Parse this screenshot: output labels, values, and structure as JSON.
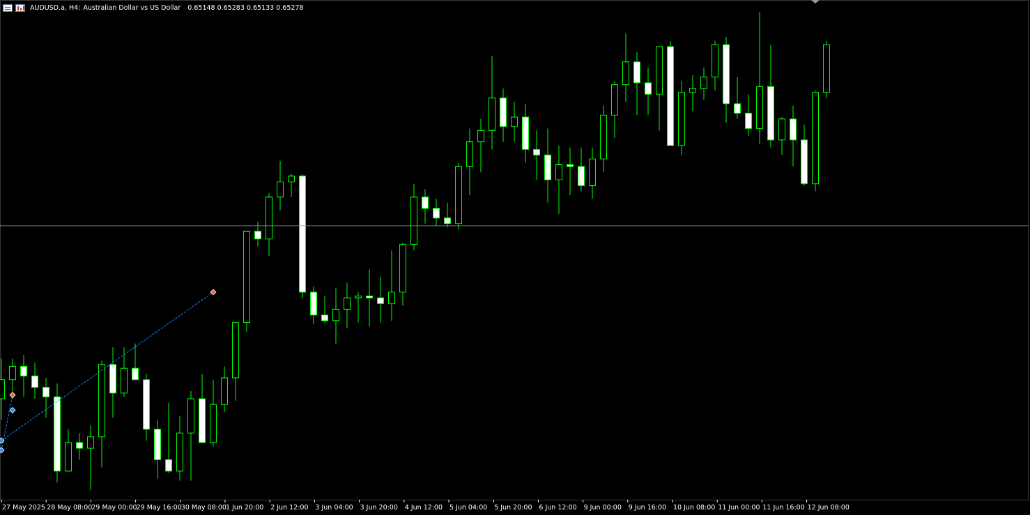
{
  "header": {
    "symbol_timeframe": "AUDUSD.a, H4:",
    "description": "Australian Dollar vs US Dollar",
    "quote": "0.65148 0.65283 0.65133 0.65278",
    "menu_icon": "window-menu-icon",
    "chart_icon": "bar-chart-icon"
  },
  "colors": {
    "background": "#000000",
    "candle_outline": "#00ff00",
    "bull_body": "#000000",
    "bear_body": "#ffffff",
    "price_line": "#8b9dae",
    "buy_marker": "#1e90ff",
    "sell_marker": "#ff5a36",
    "trade_line": "#1e90ff"
  },
  "chart_data": {
    "type": "candlestick",
    "symbol": "AUDUSD.a",
    "timeframe": "H4",
    "grid": false,
    "current_price": 0.65278,
    "x_labels": [
      "27 May 2025",
      "28 May 08:00",
      "29 May 00:00",
      "29 May 16:00",
      "30 May 08:00",
      "1 Jun 20:00",
      "2 Jun 12:00",
      "3 Jun 04:00",
      "3 Jun 20:00",
      "4 Jun 12:00",
      "5 Jun 04:00",
      "5 Jun 20:00",
      "6 Jun 12:00",
      "9 Jun 00:00",
      "9 Jun 16:00",
      "10 Jun 08:00",
      "11 Jun 00:00",
      "11 Jun 16:00",
      "12 Jun 08:00"
    ],
    "candles": [
      {
        "o": 0.6437,
        "h": 0.6458,
        "l": 0.6426,
        "c": 0.6447
      },
      {
        "o": 0.6447,
        "h": 0.6458,
        "l": 0.6437,
        "c": 0.6454
      },
      {
        "o": 0.6454,
        "h": 0.646,
        "l": 0.6438,
        "c": 0.6449
      },
      {
        "o": 0.6449,
        "h": 0.6456,
        "l": 0.6437,
        "c": 0.6443
      },
      {
        "o": 0.6443,
        "h": 0.6448,
        "l": 0.6427,
        "c": 0.6438
      },
      {
        "o": 0.6438,
        "h": 0.6445,
        "l": 0.6393,
        "c": 0.6399
      },
      {
        "o": 0.6399,
        "h": 0.6421,
        "l": 0.6399,
        "c": 0.6414
      },
      {
        "o": 0.6414,
        "h": 0.6419,
        "l": 0.6405,
        "c": 0.6411
      },
      {
        "o": 0.6411,
        "h": 0.6423,
        "l": 0.6389,
        "c": 0.6417
      },
      {
        "o": 0.6417,
        "h": 0.6457,
        "l": 0.6401,
        "c": 0.6455
      },
      {
        "o": 0.6455,
        "h": 0.6464,
        "l": 0.6427,
        "c": 0.644
      },
      {
        "o": 0.644,
        "h": 0.6464,
        "l": 0.6438,
        "c": 0.6453
      },
      {
        "o": 0.6453,
        "h": 0.6466,
        "l": 0.6447,
        "c": 0.6447
      },
      {
        "o": 0.6447,
        "h": 0.645,
        "l": 0.6415,
        "c": 0.6421
      },
      {
        "o": 0.6421,
        "h": 0.6426,
        "l": 0.6395,
        "c": 0.6405
      },
      {
        "o": 0.6405,
        "h": 0.6435,
        "l": 0.6398,
        "c": 0.6399
      },
      {
        "o": 0.6399,
        "h": 0.6428,
        "l": 0.6394,
        "c": 0.6419
      },
      {
        "o": 0.6419,
        "h": 0.6441,
        "l": 0.6394,
        "c": 0.6437
      },
      {
        "o": 0.6437,
        "h": 0.645,
        "l": 0.6418,
        "c": 0.6414
      },
      {
        "o": 0.6414,
        "h": 0.6447,
        "l": 0.6412,
        "c": 0.6434
      },
      {
        "o": 0.6434,
        "h": 0.6454,
        "l": 0.643,
        "c": 0.6448
      },
      {
        "o": 0.6448,
        "h": 0.6467,
        "l": 0.6436,
        "c": 0.6477
      },
      {
        "o": 0.6477,
        "h": 0.6515,
        "l": 0.6472,
        "c": 0.6525
      },
      {
        "o": 0.6525,
        "h": 0.653,
        "l": 0.6517,
        "c": 0.6521
      },
      {
        "o": 0.6521,
        "h": 0.6545,
        "l": 0.6512,
        "c": 0.6543
      },
      {
        "o": 0.6543,
        "h": 0.6562,
        "l": 0.6536,
        "c": 0.6551
      },
      {
        "o": 0.6551,
        "h": 0.6555,
        "l": 0.6543,
        "c": 0.6554
      },
      {
        "o": 0.6554,
        "h": 0.6555,
        "l": 0.649,
        "c": 0.6493
      },
      {
        "o": 0.6493,
        "h": 0.6496,
        "l": 0.6476,
        "c": 0.6481
      },
      {
        "o": 0.6481,
        "h": 0.6491,
        "l": 0.6477,
        "c": 0.6478
      },
      {
        "o": 0.6478,
        "h": 0.6495,
        "l": 0.6466,
        "c": 0.6484
      },
      {
        "o": 0.6484,
        "h": 0.6498,
        "l": 0.6474,
        "c": 0.649
      },
      {
        "o": 0.649,
        "h": 0.6493,
        "l": 0.6477,
        "c": 0.6491
      },
      {
        "o": 0.6491,
        "h": 0.6505,
        "l": 0.6475,
        "c": 0.649
      },
      {
        "o": 0.649,
        "h": 0.6501,
        "l": 0.6477,
        "c": 0.6487
      },
      {
        "o": 0.6487,
        "h": 0.6515,
        "l": 0.6478,
        "c": 0.6493
      },
      {
        "o": 0.6493,
        "h": 0.6519,
        "l": 0.6486,
        "c": 0.6518
      },
      {
        "o": 0.6518,
        "h": 0.655,
        "l": 0.6515,
        "c": 0.6543
      },
      {
        "o": 0.6543,
        "h": 0.6547,
        "l": 0.6529,
        "c": 0.6537
      },
      {
        "o": 0.6537,
        "h": 0.6542,
        "l": 0.6528,
        "c": 0.6532
      },
      {
        "o": 0.6532,
        "h": 0.654,
        "l": 0.6527,
        "c": 0.6529
      },
      {
        "o": 0.6529,
        "h": 0.6561,
        "l": 0.6526,
        "c": 0.6559
      },
      {
        "o": 0.6559,
        "h": 0.6579,
        "l": 0.6544,
        "c": 0.6572
      },
      {
        "o": 0.6572,
        "h": 0.6584,
        "l": 0.6556,
        "c": 0.6578
      },
      {
        "o": 0.6578,
        "h": 0.6617,
        "l": 0.6568,
        "c": 0.6595
      },
      {
        "o": 0.6595,
        "h": 0.66,
        "l": 0.6572,
        "c": 0.658
      },
      {
        "o": 0.658,
        "h": 0.6593,
        "l": 0.6572,
        "c": 0.6585
      },
      {
        "o": 0.6585,
        "h": 0.6592,
        "l": 0.6561,
        "c": 0.6568
      },
      {
        "o": 0.6568,
        "h": 0.6578,
        "l": 0.6552,
        "c": 0.6565
      },
      {
        "o": 0.6565,
        "h": 0.6579,
        "l": 0.654,
        "c": 0.6552
      },
      {
        "o": 0.6552,
        "h": 0.657,
        "l": 0.6534,
        "c": 0.656
      },
      {
        "o": 0.656,
        "h": 0.6569,
        "l": 0.6544,
        "c": 0.6559
      },
      {
        "o": 0.6559,
        "h": 0.6569,
        "l": 0.6546,
        "c": 0.6549
      },
      {
        "o": 0.6549,
        "h": 0.6569,
        "l": 0.6542,
        "c": 0.6563
      },
      {
        "o": 0.6563,
        "h": 0.6591,
        "l": 0.6556,
        "c": 0.6586
      },
      {
        "o": 0.6586,
        "h": 0.6604,
        "l": 0.6574,
        "c": 0.6602
      },
      {
        "o": 0.6602,
        "h": 0.6629,
        "l": 0.6593,
        "c": 0.6614
      },
      {
        "o": 0.6614,
        "h": 0.6619,
        "l": 0.6586,
        "c": 0.6603
      },
      {
        "o": 0.6603,
        "h": 0.6611,
        "l": 0.6586,
        "c": 0.6597
      },
      {
        "o": 0.6597,
        "h": 0.6622,
        "l": 0.6578,
        "c": 0.6622
      },
      {
        "o": 0.6622,
        "h": 0.6625,
        "l": 0.6596,
        "c": 0.657
      },
      {
        "o": 0.657,
        "h": 0.6604,
        "l": 0.6565,
        "c": 0.6598
      },
      {
        "o": 0.6598,
        "h": 0.6607,
        "l": 0.6588,
        "c": 0.66
      },
      {
        "o": 0.66,
        "h": 0.6611,
        "l": 0.6594,
        "c": 0.6606
      },
      {
        "o": 0.6606,
        "h": 0.6625,
        "l": 0.6599,
        "c": 0.6623
      },
      {
        "o": 0.6623,
        "h": 0.6627,
        "l": 0.6582,
        "c": 0.6592
      },
      {
        "o": 0.6592,
        "h": 0.6606,
        "l": 0.6584,
        "c": 0.6587
      },
      {
        "o": 0.6587,
        "h": 0.6597,
        "l": 0.6575,
        "c": 0.6579
      },
      {
        "o": 0.6579,
        "h": 0.664,
        "l": 0.6571,
        "c": 0.6601
      },
      {
        "o": 0.6601,
        "h": 0.6623,
        "l": 0.6569,
        "c": 0.6573
      },
      {
        "o": 0.6573,
        "h": 0.6585,
        "l": 0.6565,
        "c": 0.6584
      },
      {
        "o": 0.6584,
        "h": 0.6591,
        "l": 0.6559,
        "c": 0.6573
      },
      {
        "o": 0.6573,
        "h": 0.6581,
        "l": 0.6549,
        "c": 0.655
      },
      {
        "o": 0.655,
        "h": 0.6599,
        "l": 0.6546,
        "c": 0.6598
      },
      {
        "o": 0.6598,
        "h": 0.6625,
        "l": 0.6595,
        "c": 0.6623
      }
    ],
    "trades": [
      {
        "side": "buy",
        "x": 0.0,
        "price": 0.641,
        "x2": 1.0,
        "price2": 0.6439
      },
      {
        "side": "buy",
        "x": 0.0,
        "price": 0.6415,
        "x2": 19.0,
        "price2": 0.6493
      },
      {
        "side": "sell",
        "x": 1.0,
        "price": 0.6439,
        "x2": 1.0,
        "price2": 0.6439
      },
      {
        "side": "buy",
        "x": 1.0,
        "price": 0.6431,
        "x2": 1.0,
        "price2": 0.6431
      },
      {
        "side": "sell",
        "x": 19.0,
        "price": 0.6493,
        "x2": 19.0,
        "price2": 0.6493
      }
    ]
  }
}
